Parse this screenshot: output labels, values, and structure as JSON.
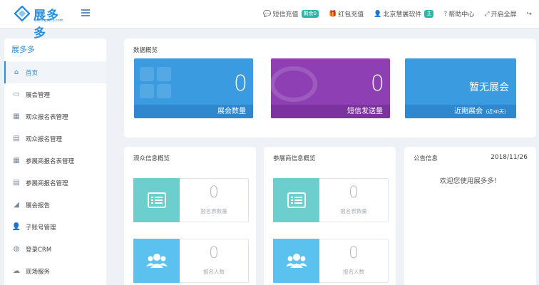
{
  "header": {
    "brand": "展多多",
    "url": "www.qooco.com",
    "nav": [
      {
        "icon": "chat-icon",
        "label": "短信充值",
        "badge": "剩余0"
      },
      {
        "icon": "gift-icon",
        "label": "红包充值"
      },
      {
        "icon": "user-icon",
        "label": "北京慧展软件",
        "badge": "主"
      },
      {
        "icon": "help-icon",
        "label": "帮助中心"
      },
      {
        "icon": "fullscreen-icon",
        "label": "开启全屏"
      },
      {
        "icon": "logout-icon",
        "label": ""
      }
    ]
  },
  "sidebar": {
    "title": "展多多",
    "items": [
      {
        "icon": "home-icon",
        "label": "首页",
        "active": true
      },
      {
        "icon": "id-card-icon",
        "label": "展会管理"
      },
      {
        "icon": "table-icon",
        "label": "观众报名表管理"
      },
      {
        "icon": "form-icon",
        "label": "观众报名管理"
      },
      {
        "icon": "table-icon",
        "label": "参展商报名表管理"
      },
      {
        "icon": "form-icon",
        "label": "参展商报名管理"
      },
      {
        "icon": "chart-icon",
        "label": "展会报告"
      },
      {
        "icon": "person-icon",
        "label": "子账号管理"
      },
      {
        "icon": "globe-icon",
        "label": "登录CRM"
      },
      {
        "icon": "cloud-icon",
        "label": "现场服务"
      }
    ]
  },
  "overview": {
    "title": "数据概览",
    "cards": [
      {
        "value": "0",
        "label": "展会数量"
      },
      {
        "value": "0",
        "label": "短信发送量"
      },
      {
        "value": "暂无展会",
        "label": "近期展会",
        "sub": "（近30天）"
      }
    ]
  },
  "audience": {
    "title": "观众信息概览",
    "rows": [
      {
        "value": "0",
        "label": "报名表数量"
      },
      {
        "value": "0",
        "label": "报名人数"
      }
    ]
  },
  "exhibitor": {
    "title": "参展商信息概览",
    "rows": [
      {
        "value": "0",
        "label": "报名表数量"
      },
      {
        "value": "0",
        "label": "报名人数"
      }
    ]
  },
  "notice": {
    "title": "公告信息",
    "date": "2018/11/26",
    "message": "欢迎您使用展多多！"
  },
  "colors": {
    "accent": "#2e8fd8",
    "card_blue": "#3b9be0",
    "card_purple": "#8e3fb3",
    "tile_teal": "#6ccfcd",
    "tile_sky": "#5bc2f0",
    "badge": "#2bb7a8"
  }
}
